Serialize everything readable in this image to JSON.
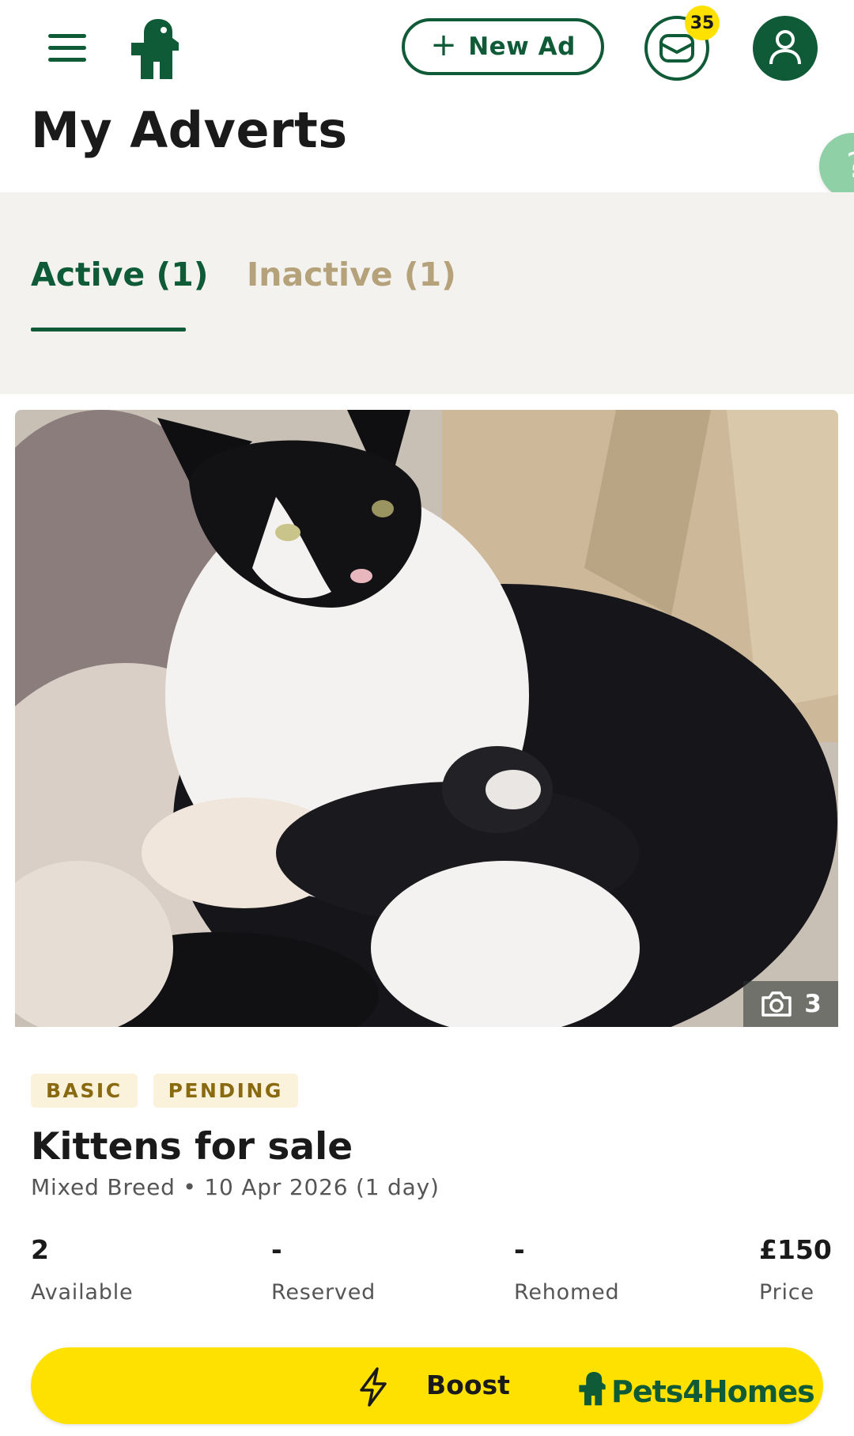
{
  "header": {
    "new_ad_label": "New Ad",
    "messages_badge": "35",
    "icons": [
      "menu-icon",
      "pets4homes-logo-icon",
      "plus-icon",
      "envelope-icon",
      "user-icon"
    ]
  },
  "page": {
    "title": "My Adverts",
    "help_glyph": "?"
  },
  "tabs": [
    {
      "label": "Active (1)",
      "selected": true
    },
    {
      "label": "Inactive (1)",
      "selected": false
    }
  ],
  "advert": {
    "photo_count": "3",
    "badges": [
      "BASIC",
      "PENDING"
    ],
    "title": "Kittens for sale",
    "meta": "Mixed Breed • 10 Apr 2026 (1 day)",
    "stats": [
      {
        "value": "2",
        "label": "Available"
      },
      {
        "value": "-",
        "label": "Reserved"
      },
      {
        "value": "-",
        "label": "Rehomed"
      },
      {
        "value": "£150",
        "label": "Price"
      }
    ]
  },
  "boost": {
    "label": "Boost",
    "brand": "Pets4Homes"
  },
  "colors": {
    "brand_green": "#0f5a37",
    "boost_yellow": "#ffe100",
    "tab_inactive": "#b5a27a",
    "tabs_bg": "#f3f2ee"
  }
}
